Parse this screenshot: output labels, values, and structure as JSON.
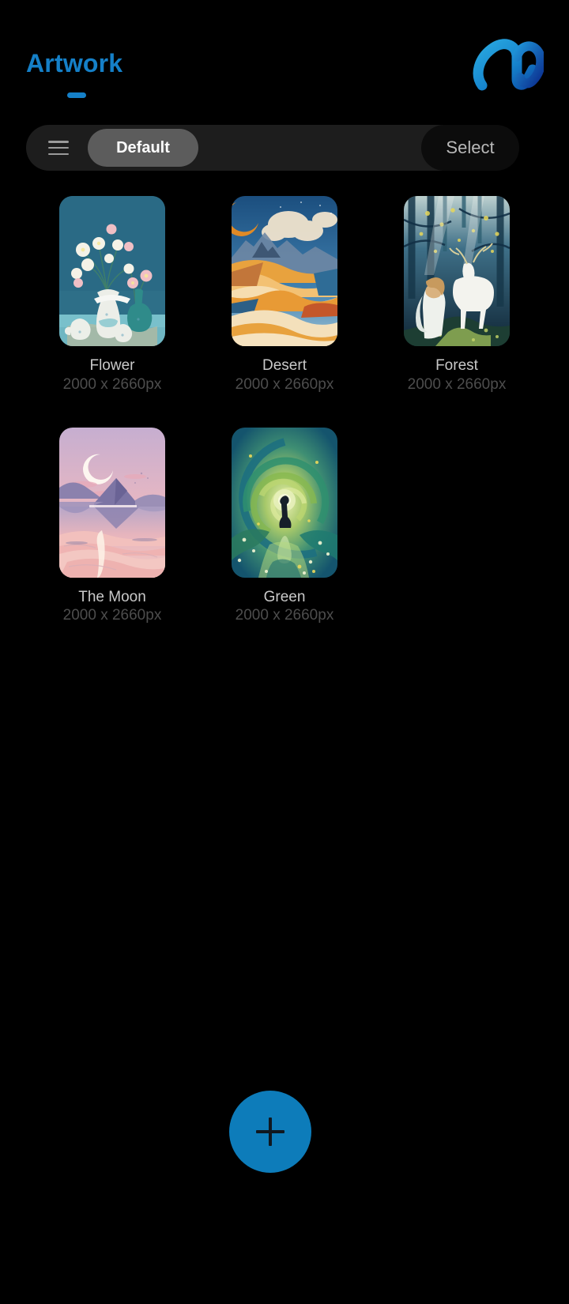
{
  "header": {
    "title": "Artwork",
    "accent_color": "#1580c8",
    "logo_icon": "brand-m-ribbon-logo"
  },
  "toolbar": {
    "menu_icon": "hamburger-menu-icon",
    "preset_label": "Default",
    "select_label": "Select",
    "bar_color": "#1d1d1d",
    "chip_color": "#5c5c5c",
    "select_color": "#0c0c0c"
  },
  "gallery": {
    "items": [
      {
        "title": "Flower",
        "dimensions": "2000 x 2660px",
        "art": "flower-vase-still-life"
      },
      {
        "title": "Desert",
        "dimensions": "2000 x 2660px",
        "art": "desert-dunes-crescent-moon"
      },
      {
        "title": "Forest",
        "dimensions": "2000 x 2660px",
        "art": "forest-white-deer-woman"
      },
      {
        "title": "The Moon",
        "dimensions": "2000 x 2660px",
        "art": "pastel-lake-crescent-moon"
      },
      {
        "title": "Green",
        "dimensions": "2000 x 2660px",
        "art": "green-spiral-tunnel-figure"
      }
    ]
  },
  "fab": {
    "label": "+",
    "icon": "plus-icon",
    "color": "#0d7cba"
  }
}
